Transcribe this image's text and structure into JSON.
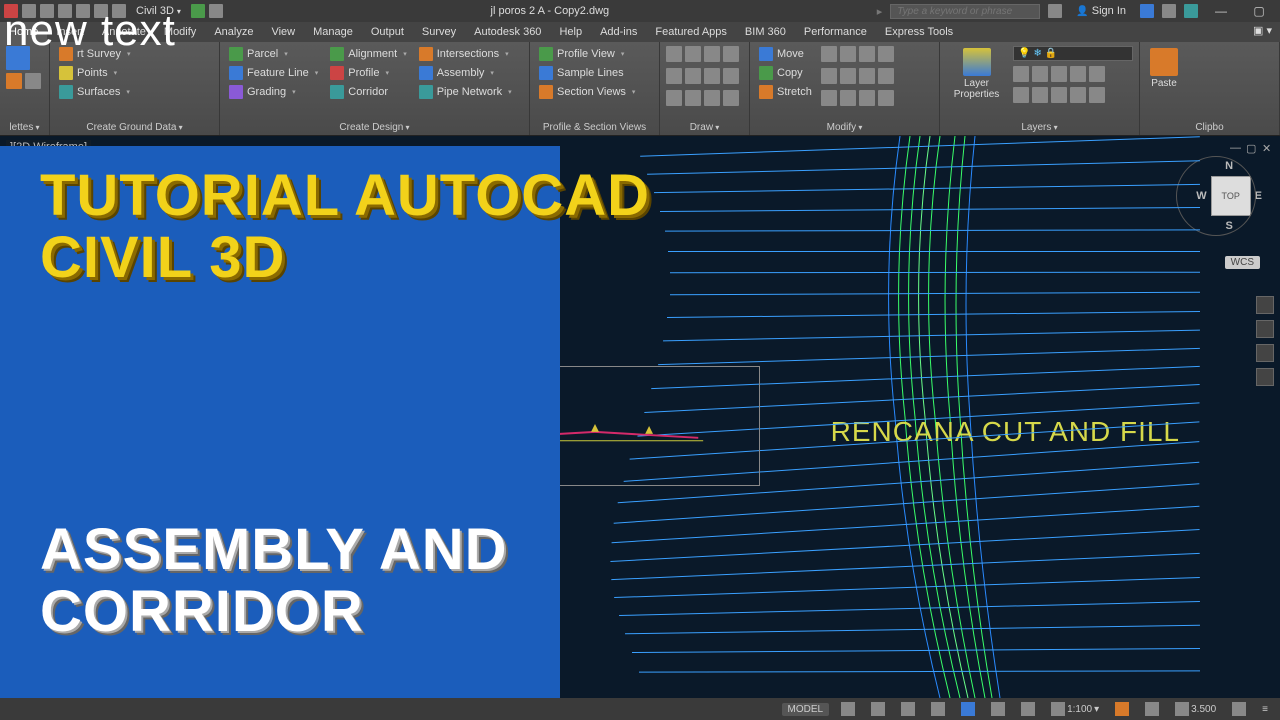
{
  "titlebar": {
    "workspace": "Civil 3D",
    "filename": "jl poros 2 A - Copy2.dwg",
    "search_placeholder": "Type a keyword or phrase",
    "sign_in": "Sign In"
  },
  "menu": {
    "items": [
      "Home",
      "Insert",
      "Annotate",
      "Modify",
      "Analyze",
      "View",
      "Manage",
      "Output",
      "Survey",
      "Autodesk 360",
      "Help",
      "Add-ins",
      "Featured Apps",
      "BIM 360",
      "Performance",
      "Express Tools"
    ],
    "active": 0
  },
  "ribbon": {
    "palettes": {
      "title": "lettes"
    },
    "ground": {
      "title": "Create Ground Data",
      "btns": [
        "rt Survey",
        "Points",
        "Surfaces"
      ]
    },
    "parcel_row": [
      "Parcel",
      "Feature Line",
      "Grading"
    ],
    "design": {
      "title": "Create Design",
      "col1": [
        "Alignment",
        "Profile",
        "Corridor"
      ],
      "col2": [
        "Intersections",
        "Assembly",
        "Pipe Network"
      ]
    },
    "profile": {
      "title": "Profile & Section Views",
      "btns": [
        "Profile View",
        "Sample Lines",
        "Section Views"
      ]
    },
    "draw": {
      "title": "Draw"
    },
    "modify": {
      "title": "Modify",
      "btns": [
        "Move",
        "Copy",
        "Stretch"
      ]
    },
    "layers": {
      "title": "Layers",
      "big": "Layer\nProperties"
    },
    "clipboard": {
      "title": "Clipbo",
      "big": "Paste"
    }
  },
  "viewport": {
    "label": "][2D Wireframe]",
    "cube": {
      "n": "N",
      "e": "E",
      "s": "S",
      "w": "W",
      "top": "TOP"
    },
    "wcs": "WCS",
    "drawing_title": "RENCANA CUT AND FILL"
  },
  "overlay": {
    "newtext": "new text",
    "line1": "TUTORIAL AUTOCAD",
    "line2": "CIVIL 3D",
    "line3": "ASSEMBLY AND",
    "line4": "CORRIDOR"
  },
  "statusbar": {
    "model": "MODEL",
    "scale": "1:100",
    "value": "3.500"
  }
}
